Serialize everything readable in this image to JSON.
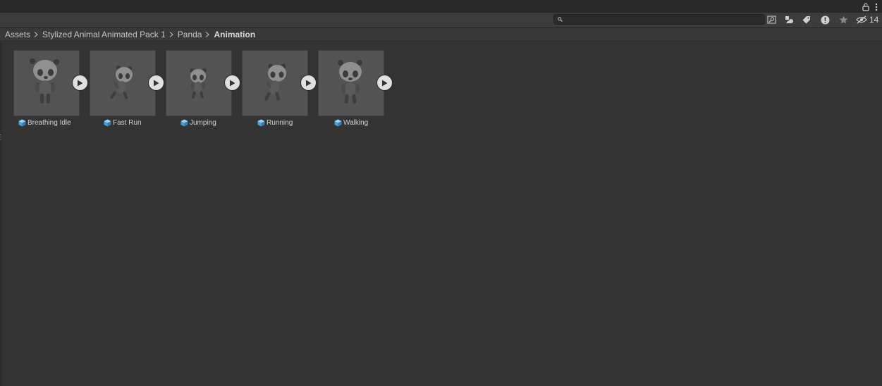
{
  "toolbar": {
    "search_placeholder": "",
    "hidden_count": "14"
  },
  "breadcrumb": {
    "items": [
      "Assets",
      "Stylized Animal Animated Pack 1",
      "Panda",
      "Animation"
    ]
  },
  "assets": [
    {
      "name": "Breathing Idle",
      "icon": "model-icon"
    },
    {
      "name": "Fast Run",
      "icon": "model-icon"
    },
    {
      "name": "Jumping",
      "icon": "model-icon"
    },
    {
      "name": "Running",
      "icon": "model-icon"
    },
    {
      "name": "Walking",
      "icon": "model-icon"
    }
  ],
  "colors": {
    "background": "#323232",
    "titlebar": "#282828",
    "toolbar": "#3c3c3c",
    "tile": "#535353",
    "model_icon": "#4aa3d8",
    "text": "#c4c4c4"
  }
}
